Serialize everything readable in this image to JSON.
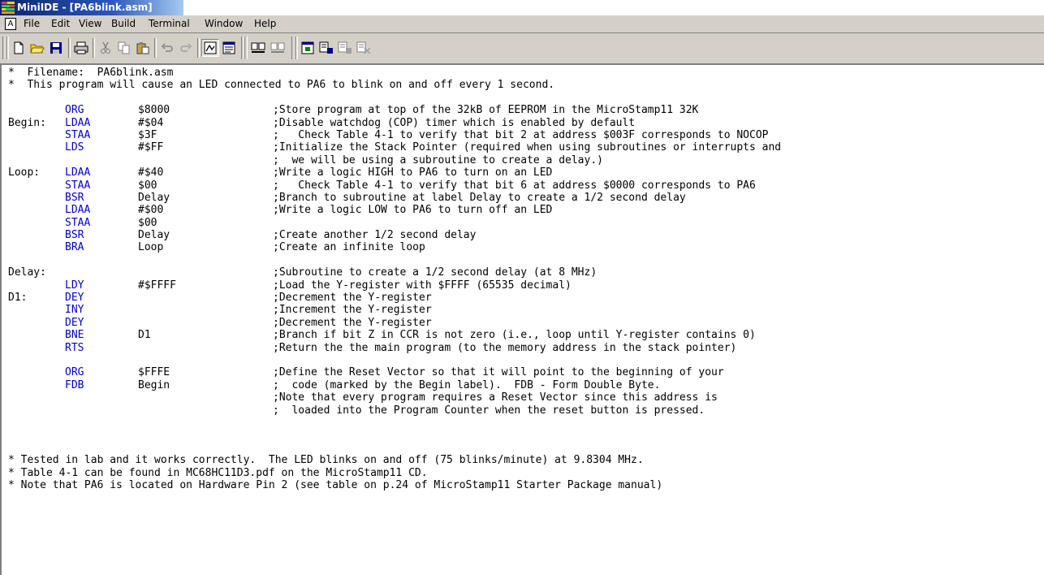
{
  "window": {
    "title": "MiniIDE - [PA6blink.asm]",
    "app_icon": "miniide-stack-icon"
  },
  "menu": [
    "File",
    "Edit",
    "View",
    "Build",
    "Terminal",
    "Window",
    "Help"
  ],
  "toolbar": {
    "buttons": [
      "new-file",
      "open-folder",
      "save",
      "print",
      "cut",
      "copy",
      "paste",
      "undo",
      "redo",
      "toggle-view-pressed",
      "output-window",
      "build",
      "build-all",
      "terminal",
      "download",
      "step",
      "stop"
    ]
  },
  "editor": {
    "lines": [
      {
        "kind": "header",
        "text": "*  Filename:  PA6blink.asm"
      },
      {
        "kind": "header",
        "text": "*  This program will cause an LED connected to PA6 to blink on and off every 1 second."
      },
      {
        "kind": "blank"
      },
      {
        "kind": "code",
        "label": "",
        "op": "ORG",
        "arg": "$8000",
        "comment": ";Store program at top of the 32kB of EEPROM in the MicroStamp11 32K"
      },
      {
        "kind": "code",
        "label": "Begin:",
        "op": "LDAA",
        "arg": "#$04",
        "comment": ";Disable watchdog (COP) timer which is enabled by default"
      },
      {
        "kind": "code",
        "label": "",
        "op": "STAA",
        "arg": "$3F",
        "comment": ";   Check Table 4-1 to verify that bit 2 at address $003F corresponds to NOCOP"
      },
      {
        "kind": "code",
        "label": "",
        "op": "LDS",
        "arg": "#$FF",
        "comment": ";Initialize the Stack Pointer (required when using subroutines or interrupts and"
      },
      {
        "kind": "code",
        "label": "",
        "op": "",
        "arg": "",
        "comment": ";  we will be using a subroutine to create a delay.)"
      },
      {
        "kind": "code",
        "label": "Loop:",
        "op": "LDAA",
        "arg": "#$40",
        "comment": ";Write a logic HIGH to PA6 to turn on an LED"
      },
      {
        "kind": "code",
        "label": "",
        "op": "STAA",
        "arg": "$00",
        "comment": ";   Check Table 4-1 to verify that bit 6 at address $0000 corresponds to PA6"
      },
      {
        "kind": "code",
        "label": "",
        "op": "BSR",
        "arg": "Delay",
        "comment": ";Branch to subroutine at label Delay to create a 1/2 second delay"
      },
      {
        "kind": "code",
        "label": "",
        "op": "LDAA",
        "arg": "#$00",
        "comment": ";Write a logic LOW to PA6 to turn off an LED"
      },
      {
        "kind": "code",
        "label": "",
        "op": "STAA",
        "arg": "$00",
        "comment": ""
      },
      {
        "kind": "code",
        "label": "",
        "op": "BSR",
        "arg": "Delay",
        "comment": ";Create another 1/2 second delay"
      },
      {
        "kind": "code",
        "label": "",
        "op": "BRA",
        "arg": "Loop",
        "comment": ";Create an infinite loop"
      },
      {
        "kind": "blank"
      },
      {
        "kind": "code",
        "label": "Delay:",
        "op": "",
        "arg": "",
        "comment": ";Subroutine to create a 1/2 second delay (at 8 MHz)"
      },
      {
        "kind": "code",
        "label": "",
        "op": "LDY",
        "arg": "#$FFFF",
        "comment": ";Load the Y-register with $FFFF (65535 decimal)"
      },
      {
        "kind": "code",
        "label": "D1:",
        "op": "DEY",
        "arg": "",
        "comment": ";Decrement the Y-register"
      },
      {
        "kind": "code",
        "label": "",
        "op": "INY",
        "arg": "",
        "comment": ";Increment the Y-register"
      },
      {
        "kind": "code",
        "label": "",
        "op": "DEY",
        "arg": "",
        "comment": ";Decrement the Y-register"
      },
      {
        "kind": "code",
        "label": "",
        "op": "BNE",
        "arg": "D1",
        "comment": ";Branch if bit Z in CCR is not zero (i.e., loop until Y-register contains 0)"
      },
      {
        "kind": "code",
        "label": "",
        "op": "RTS",
        "arg": "",
        "comment": ";Return the the main program (to the memory address in the stack pointer)"
      },
      {
        "kind": "blank"
      },
      {
        "kind": "code",
        "label": "",
        "op": "ORG",
        "arg": "$FFFE",
        "comment": ";Define the Reset Vector so that it will point to the beginning of your"
      },
      {
        "kind": "code",
        "label": "",
        "op": "FDB",
        "arg": "Begin",
        "comment": ";  code (marked by the Begin label).  FDB - Form Double Byte."
      },
      {
        "kind": "code",
        "label": "",
        "op": "",
        "arg": "",
        "comment": ";Note that every program requires a Reset Vector since this address is"
      },
      {
        "kind": "code",
        "label": "",
        "op": "",
        "arg": "",
        "comment": ";  loaded into the Program Counter when the reset button is pressed."
      },
      {
        "kind": "blank"
      },
      {
        "kind": "blank"
      },
      {
        "kind": "blank"
      },
      {
        "kind": "footer",
        "text": "* Tested in lab and it works correctly.  The LED blinks on and off (75 blinks/minute) at 9.8304 MHz."
      },
      {
        "kind": "footer",
        "text": "* Table 4-1 can be found in MC68HC11D3.pdf on the MicroStamp11 CD."
      },
      {
        "kind": "footer",
        "text": "* Note that PA6 is located on Hardware Pin 2 (see table on p.24 of MicroStamp11 Starter Package manual)"
      }
    ]
  }
}
